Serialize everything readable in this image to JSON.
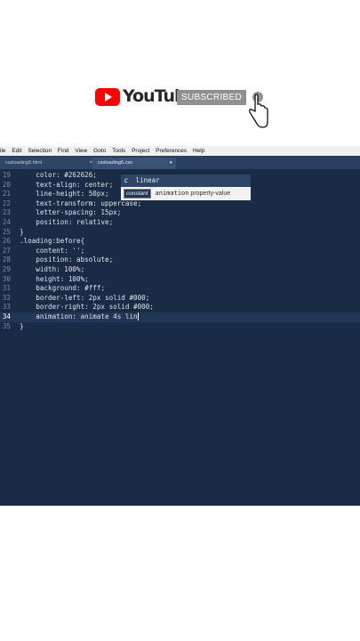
{
  "banner": {
    "brand": "YouTube",
    "subscribe_label": "SUBSCRIBED"
  },
  "menubar": [
    "ile",
    "Edit",
    "Selection",
    "Find",
    "View",
    "Goto",
    "Tools",
    "Project",
    "Preferences",
    "Help"
  ],
  "tabs": [
    {
      "label": "cssloading6.html",
      "active": false
    },
    {
      "label": "cssloading6.css",
      "active": true
    }
  ],
  "code_lines": [
    {
      "n": "19",
      "text": "    color: #262626;"
    },
    {
      "n": "20",
      "text": "    text-align: center;"
    },
    {
      "n": "21",
      "text": "    line-height: 50px;"
    },
    {
      "n": "22",
      "text": "    text-transform: uppercase;"
    },
    {
      "n": "23",
      "text": "    letter-spacing: 15px;"
    },
    {
      "n": "24",
      "text": "    position: relative;"
    },
    {
      "n": "25",
      "text": "}"
    },
    {
      "n": "26",
      "text": ".loading:before{"
    },
    {
      "n": "27",
      "text": "    content: '';"
    },
    {
      "n": "28",
      "text": "    position: absolute;"
    },
    {
      "n": "29",
      "text": "    width: 100%;"
    },
    {
      "n": "30",
      "text": "    height: 100%;"
    },
    {
      "n": "31",
      "text": "    background: #fff;"
    },
    {
      "n": "32",
      "text": "    border-left: 2px solid #000;"
    },
    {
      "n": "33",
      "text": "    border-right: 2px solid #000;"
    },
    {
      "n": "34",
      "text": "    animation: animate 4s lin"
    },
    {
      "n": "35",
      "text": "}"
    }
  ],
  "autocomplete": {
    "kind": "c",
    "suggestion": "linear",
    "tag": "constant",
    "name": "animation",
    "detail": "property-value"
  }
}
